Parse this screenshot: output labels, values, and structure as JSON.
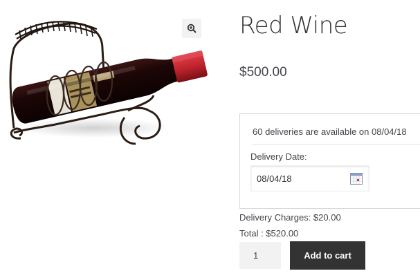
{
  "product": {
    "title": "Red Wine",
    "price": "$500.00",
    "image_icon": "wine-bottle-in-rack",
    "zoom_icon": "magnifier-plus-icon"
  },
  "delivery": {
    "availability": "60 deliveries are available on 08/04/18",
    "date_label": "Delivery Date:",
    "date_value": "08/04/18",
    "calendar_icon": "calendar-icon",
    "charges": "Delivery Charges: $20.00",
    "total": "Total : $520.00"
  },
  "cart": {
    "quantity": "1",
    "add_label": "Add to cart"
  },
  "colors": {
    "button": "#333333",
    "text": "#43454b",
    "wine_cap": "#c2252f"
  }
}
